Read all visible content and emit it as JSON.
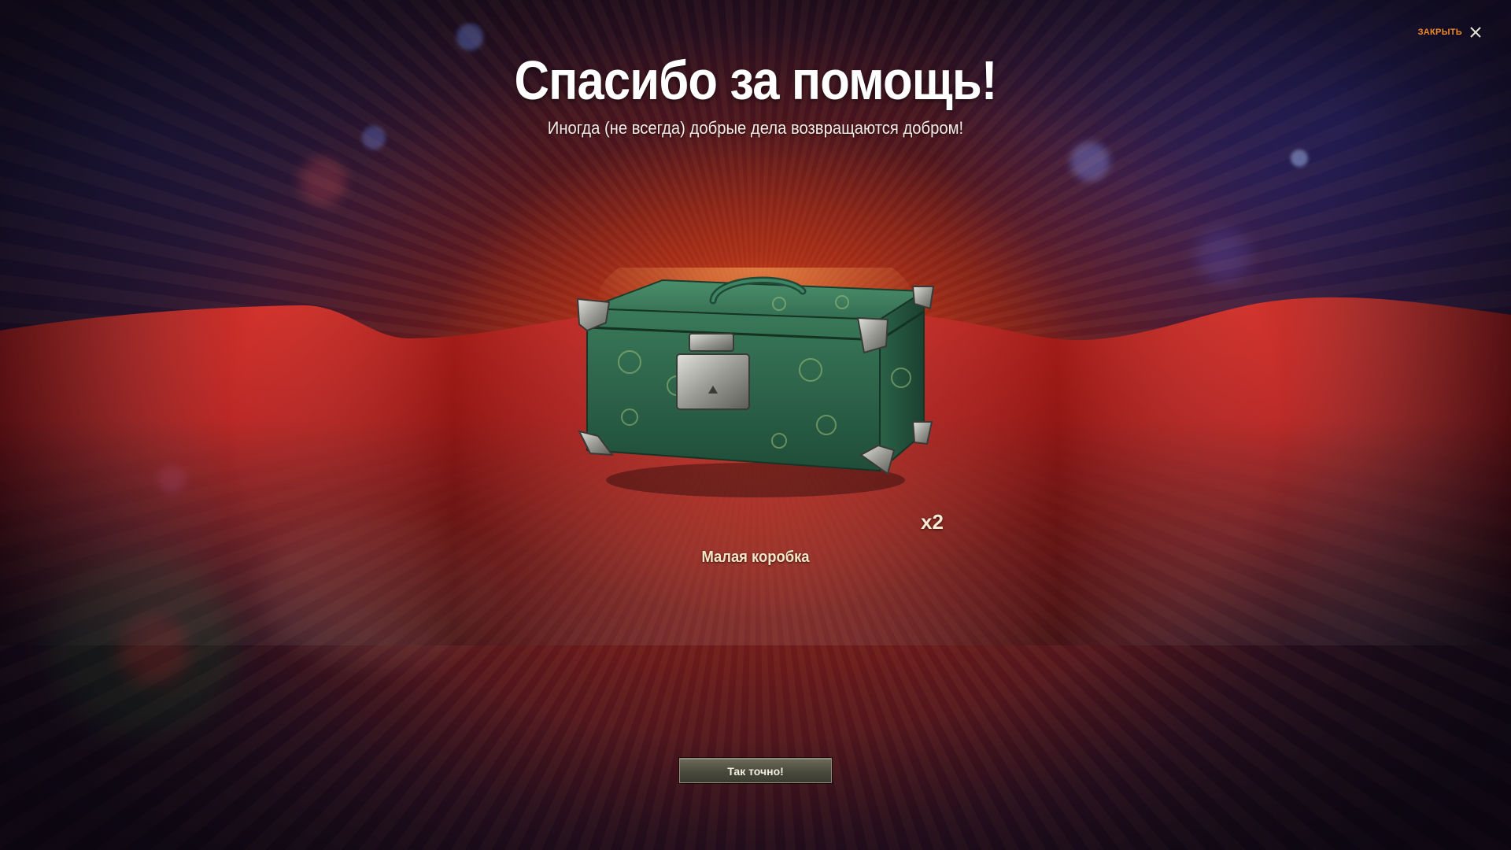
{
  "header": {
    "close_label": "ЗАКРЫТЬ"
  },
  "main": {
    "title": "Спасибо за помощь!",
    "subtitle": "Иногда (не всегда) добрые дела возвращаются добром!"
  },
  "reward": {
    "name": "Малая коробка",
    "count": "x2",
    "icon": "gift-box-icon"
  },
  "actions": {
    "confirm_label": "Так точно!"
  },
  "colors": {
    "accent": "#f08a2a",
    "cloth": "#c8201c",
    "box": "#2f6b4e"
  }
}
